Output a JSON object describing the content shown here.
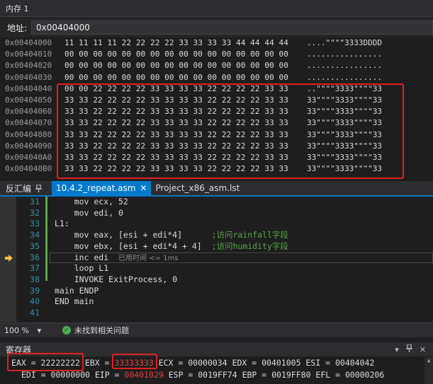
{
  "memory": {
    "title": "内存 1",
    "address_label": "地址:",
    "address_value": "0x00404000",
    "rows": [
      {
        "addr": "0x00404000",
        "bytes": "11 11 11 11 22 22 22 22 33 33 33 33 44 44 44 44",
        "ascii": "....\"\"\"\"3333DDDD"
      },
      {
        "addr": "0x00404010",
        "bytes": "00 00 00 00 00 00 00 00 00 00 00 00 00 00 00 00",
        "ascii": "................"
      },
      {
        "addr": "0x00404020",
        "bytes": "00 00 00 00 00 00 00 00 00 00 00 00 00 00 00 00",
        "ascii": "................"
      },
      {
        "addr": "0x00404030",
        "bytes": "00 00 00 00 00 00 00 00 00 00 00 00 00 00 00 00",
        "ascii": "................"
      },
      {
        "addr": "0x00404040",
        "bytes": "00 00 22 22 22 22 33 33 33 33 22 22 22 22 33 33",
        "ascii": "..\"\"\"\"3333\"\"\"\"33"
      },
      {
        "addr": "0x00404050",
        "bytes": "33 33 22 22 22 22 33 33 33 33 22 22 22 22 33 33",
        "ascii": "33\"\"\"\"3333\"\"\"\"33"
      },
      {
        "addr": "0x00404060",
        "bytes": "33 33 22 22 22 22 33 33 33 33 22 22 22 22 33 33",
        "ascii": "33\"\"\"\"3333\"\"\"\"33"
      },
      {
        "addr": "0x00404070",
        "bytes": "33 33 22 22 22 22 33 33 33 33 22 22 22 22 33 33",
        "ascii": "33\"\"\"\"3333\"\"\"\"33"
      },
      {
        "addr": "0x00404080",
        "bytes": "33 33 22 22 22 22 33 33 33 33 22 22 22 22 33 33",
        "ascii": "33\"\"\"\"3333\"\"\"\"33"
      },
      {
        "addr": "0x00404090",
        "bytes": "33 33 22 22 22 22 33 33 33 33 22 22 22 22 33 33",
        "ascii": "33\"\"\"\"3333\"\"\"\"33"
      },
      {
        "addr": "0x004040A0",
        "bytes": "33 33 22 22 22 22 33 33 33 33 22 22 22 22 33 33",
        "ascii": "33\"\"\"\"3333\"\"\"\"33"
      },
      {
        "addr": "0x004040B0",
        "bytes": "33 33 22 22 22 22 33 33 33 33 22 22 22 22 33 33",
        "ascii": "33\"\"\"\"3333\"\"\"\"33"
      }
    ]
  },
  "disassembly": {
    "panel_label": "反汇编",
    "pin_icon": "pin-icon",
    "tabs": [
      {
        "label": "10.4.2_repeat.asm",
        "active": true,
        "close": "✕"
      },
      {
        "label": "Project_x86_asm.lst",
        "active": false,
        "close": ""
      }
    ],
    "lines": [
      {
        "num": "31",
        "code": "    mov ecx, 52",
        "comment": "",
        "hint": ""
      },
      {
        "num": "32",
        "code": "    mov edi, 0",
        "comment": "",
        "hint": ""
      },
      {
        "num": "33",
        "code": "L1:",
        "comment": "",
        "hint": ""
      },
      {
        "num": "34",
        "code": "    mov eax, [esi + edi*4]      ",
        "comment": ";访问rainfall字段",
        "hint": ""
      },
      {
        "num": "35",
        "code": "    mov ebx, [esi + edi*4 + 4]  ",
        "comment": ";访问humidity字段",
        "hint": ""
      },
      {
        "num": "36",
        "code": "    inc edi  ",
        "comment": "",
        "hint": "已用时间 <= 1ms"
      },
      {
        "num": "37",
        "code": "    loop L1",
        "comment": "",
        "hint": ""
      },
      {
        "num": "38",
        "code": "    INVOKE ExitProcess, 0",
        "comment": "",
        "hint": ""
      },
      {
        "num": "39",
        "code": "main ENDP",
        "comment": "",
        "hint": ""
      },
      {
        "num": "40",
        "code": "END main",
        "comment": "",
        "hint": ""
      },
      {
        "num": "41",
        "code": "",
        "comment": "",
        "hint": ""
      }
    ],
    "current_line_index": 5
  },
  "status": {
    "zoom": "100 %",
    "zoom_arrow": "▾",
    "issue_text": "未找到相关问题"
  },
  "registers": {
    "title": "寄存器",
    "line1": {
      "eax_label": "EAX = ",
      "eax_value": "22222222",
      "ebx_label": " EBX = ",
      "ebx_value": "33333333",
      "rest": " ECX = 00000034 EDX = 00401005 ESI = 00404042"
    },
    "line2": {
      "edi": "EDI = 00000000 EIP = ",
      "eip_value": "00401029",
      "rest": " ESP = 0019FF74 EBP = 0019FF80 EFL = 00000206"
    },
    "colors": {
      "changed": "#e04040",
      "highlight_box": "#e02020"
    }
  }
}
